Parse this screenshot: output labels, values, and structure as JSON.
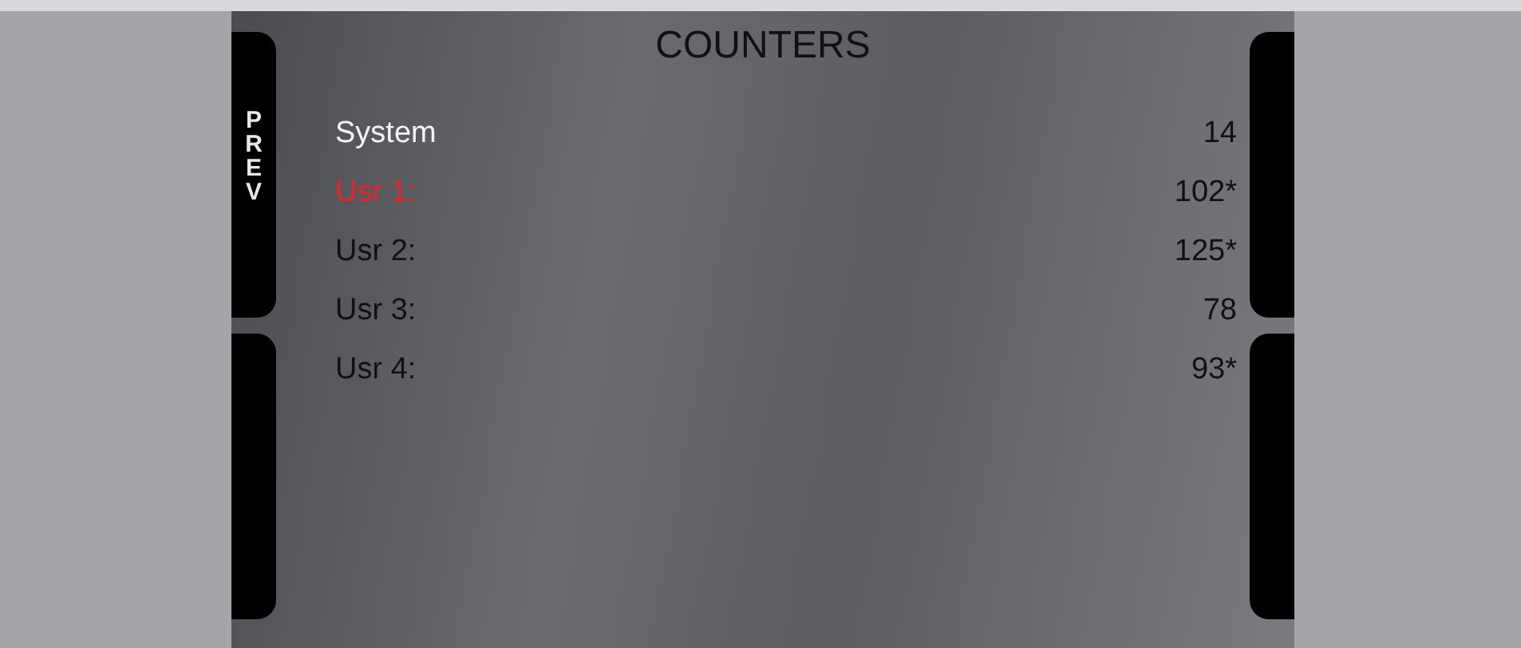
{
  "title": "COUNTERS",
  "side_buttons": {
    "left": [
      {
        "kind": "text",
        "label": "PREV"
      },
      {
        "kind": "blank"
      }
    ],
    "right": [
      {
        "kind": "blank"
      },
      {
        "kind": "blank"
      }
    ]
  },
  "rows": [
    {
      "kind": "system",
      "label": "System",
      "value": "14",
      "selected": false
    },
    {
      "kind": "user",
      "label": "Usr 1:",
      "value": "102*",
      "selected": true
    },
    {
      "kind": "user",
      "label": "Usr 2:",
      "value": "125*",
      "selected": false
    },
    {
      "kind": "user",
      "label": "Usr 3:",
      "value": "78",
      "selected": false
    },
    {
      "kind": "user",
      "label": "Usr 4:",
      "value": "93*",
      "selected": false
    }
  ]
}
